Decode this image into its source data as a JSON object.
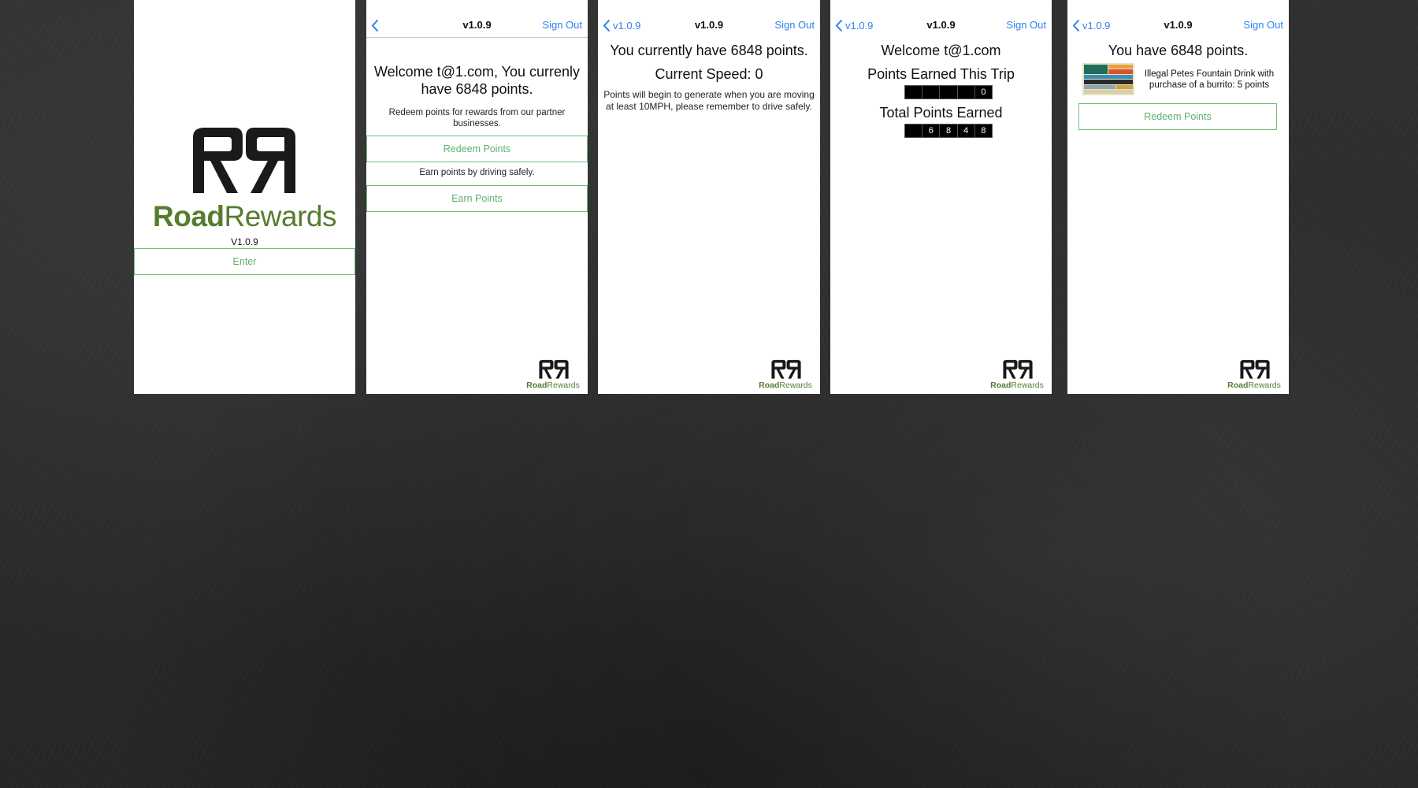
{
  "colors": {
    "brand_green": "#567d2e",
    "button_green": "#5fb06c",
    "ios_blue": "#2f7ff0",
    "chalkboard": "#2b2b2b"
  },
  "brand": {
    "bold": "Road",
    "light": "Rewards"
  },
  "nav": {
    "version": "v1.0.9",
    "sign_out": "Sign Out",
    "back_icon": "chevron-left-icon"
  },
  "screen1": {
    "version": "V1.0.9",
    "enter_label": "Enter"
  },
  "screen2": {
    "welcome": "Welcome t@1.com, You currenly have 6848 points.",
    "redeem_text": "Redeem points for rewards from our partner businesses.",
    "redeem_button": "Redeem Points",
    "earn_text": "Earn points by driving safely.",
    "earn_button": "Earn Points"
  },
  "screen3": {
    "points_text": "You currently have 6848 points.",
    "speed_text": "Current Speed: 0",
    "note": "Points will begin to generate when you are moving at least 10MPH, please remember to drive safely."
  },
  "screen4": {
    "welcome": "Welcome t@1.com",
    "trip_label": "Points Earned This Trip",
    "trip_digits": [
      "",
      "",
      "",
      "",
      "0"
    ],
    "total_label": "Total Points Earned",
    "total_digits": [
      "6",
      "8",
      "4",
      "8"
    ]
  },
  "screen5": {
    "points_text": "You have 6848 points.",
    "reward_text": "Illegal Petes Fountain Drink with purchase of a burrito: 5 points",
    "redeem_button": "Redeem Points"
  }
}
